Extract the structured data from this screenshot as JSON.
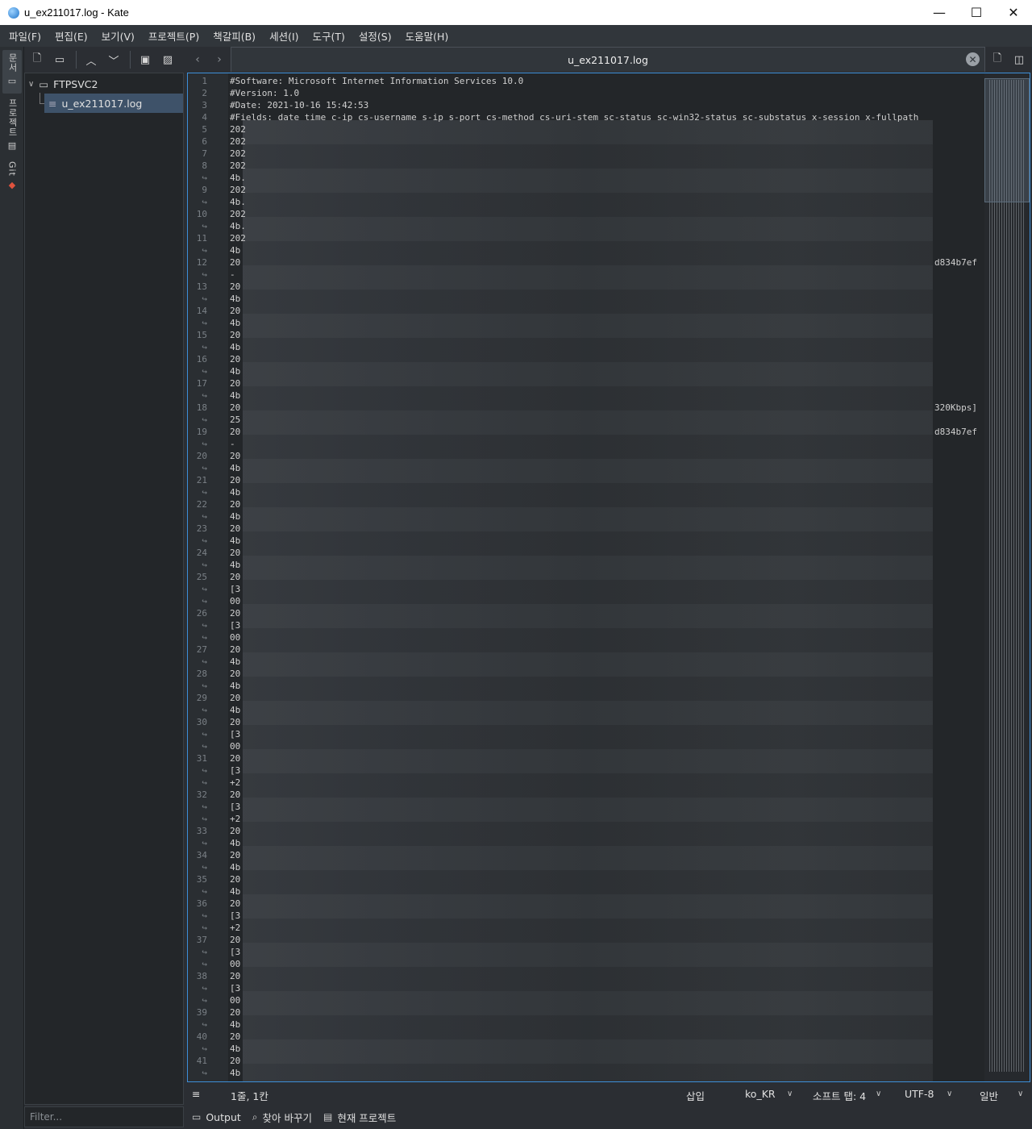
{
  "window": {
    "title": "u_ex211017.log  - Kate",
    "min": "—",
    "max": "☐",
    "close": "✕"
  },
  "menu": [
    "파일(F)",
    "편집(E)",
    "보기(V)",
    "프로젝트(P)",
    "책갈피(B)",
    "세션(I)",
    "도구(T)",
    "설정(S)",
    "도움말(H)"
  ],
  "sidebar_tabs": [
    "문서",
    "프로젝트",
    "Git"
  ],
  "toolbar": {
    "new_icon": "new-document-icon",
    "open_icon": "open-folder-icon",
    "up_icon": "chevron-up-icon",
    "down_icon": "chevron-down-icon",
    "save_icon": "save-icon",
    "save_as_icon": "save-as-icon"
  },
  "tree": {
    "root": "FTPSVC2",
    "file": "u_ex211017.log"
  },
  "filter": {
    "placeholder": "Filter..."
  },
  "tab": {
    "label": "u_ex211017.log",
    "close": "✕"
  },
  "editor": {
    "header_lines": [
      "#Software: Microsoft Internet Information Services 10.0",
      "#Version: 1.0",
      "#Date: 2021-10-16 15:42:53",
      "#Fields: date time c-ip cs-username s-ip s-port cs-method cs-uri-stem sc-status sc-win32-status sc-substatus x-session x-fullpath"
    ],
    "rows": [
      [
        "5",
        "202",
        ""
      ],
      [
        "6",
        "202",
        ""
      ],
      [
        "7",
        "202",
        ""
      ],
      [
        "8",
        "202",
        ""
      ],
      [
        "↪",
        "4b.",
        ""
      ],
      [
        "9",
        "202",
        ""
      ],
      [
        "↪",
        "4b.",
        ""
      ],
      [
        "10",
        "202",
        ""
      ],
      [
        "↪",
        "4b.",
        ""
      ],
      [
        "11",
        "202",
        ""
      ],
      [
        "↪",
        "4b",
        ""
      ],
      [
        "12",
        "20",
        "d834b7ef"
      ],
      [
        "↪",
        "-",
        ""
      ],
      [
        "13",
        "20",
        ""
      ],
      [
        "↪",
        "4b",
        ""
      ],
      [
        "14",
        "20",
        ""
      ],
      [
        "↪",
        "4b",
        ""
      ],
      [
        "15",
        "20",
        ""
      ],
      [
        "↪",
        "4b",
        ""
      ],
      [
        "16",
        "20",
        ""
      ],
      [
        "↪",
        "4b",
        ""
      ],
      [
        "17",
        "20",
        ""
      ],
      [
        "↪",
        "4b",
        ""
      ],
      [
        "18",
        "20",
        "320Kbps]"
      ],
      [
        "↪",
        "25",
        ""
      ],
      [
        "19",
        "20",
        "d834b7ef"
      ],
      [
        "↪",
        "-",
        ""
      ],
      [
        "20",
        "20",
        ""
      ],
      [
        "↪",
        "4b",
        ""
      ],
      [
        "21",
        "20",
        ""
      ],
      [
        "↪",
        "4b",
        ""
      ],
      [
        "22",
        "20",
        ""
      ],
      [
        "↪",
        "4b",
        ""
      ],
      [
        "23",
        "20",
        ""
      ],
      [
        "↪",
        "4b",
        ""
      ],
      [
        "24",
        "20",
        ""
      ],
      [
        "↪",
        "4b",
        ""
      ],
      [
        "25",
        "20",
        ""
      ],
      [
        "↪",
        "[3",
        ""
      ],
      [
        "↪",
        "00",
        ""
      ],
      [
        "26",
        "20",
        ""
      ],
      [
        "↪",
        "[3",
        ""
      ],
      [
        "↪",
        "00",
        ""
      ],
      [
        "27",
        "20",
        ""
      ],
      [
        "↪",
        "4b",
        ""
      ],
      [
        "28",
        "20",
        ""
      ],
      [
        "↪",
        "4b",
        ""
      ],
      [
        "29",
        "20",
        ""
      ],
      [
        "↪",
        "4b",
        ""
      ],
      [
        "30",
        "20",
        ""
      ],
      [
        "↪",
        "[3",
        ""
      ],
      [
        "↪",
        "00",
        ""
      ],
      [
        "31",
        "20",
        ""
      ],
      [
        "↪",
        "[3",
        ""
      ],
      [
        "↪",
        "+2",
        ""
      ],
      [
        "32",
        "20",
        ""
      ],
      [
        "↪",
        "[3",
        ""
      ],
      [
        "↪",
        "+2",
        ""
      ],
      [
        "33",
        "20",
        ""
      ],
      [
        "↪",
        "4b",
        ""
      ],
      [
        "34",
        "20",
        ""
      ],
      [
        "↪",
        "4b",
        ""
      ],
      [
        "35",
        "20",
        ""
      ],
      [
        "↪",
        "4b",
        ""
      ],
      [
        "36",
        "20",
        ""
      ],
      [
        "↪",
        "[3",
        ""
      ],
      [
        "↪",
        "+2",
        ""
      ],
      [
        "37",
        "20",
        ""
      ],
      [
        "↪",
        "[3",
        ""
      ],
      [
        "↪",
        "00",
        ""
      ],
      [
        "38",
        "20",
        ""
      ],
      [
        "↪",
        "[3",
        ""
      ],
      [
        "↪",
        "00",
        ""
      ],
      [
        "39",
        "20",
        ""
      ],
      [
        "↪",
        "4b",
        ""
      ],
      [
        "40",
        "20",
        ""
      ],
      [
        "↪",
        "4b",
        ""
      ],
      [
        "41",
        "20",
        ""
      ],
      [
        "↪",
        "4b",
        ""
      ]
    ]
  },
  "status": {
    "position": "1줄, 1칸",
    "mode": "삽입",
    "language": "ko_KR",
    "indent": "소프트 탭: 4",
    "encoding": "UTF-8",
    "syntax": "일반"
  },
  "bottom": {
    "output": "Output",
    "search": "찾아 바꾸기",
    "project": "현재 프로젝트"
  }
}
